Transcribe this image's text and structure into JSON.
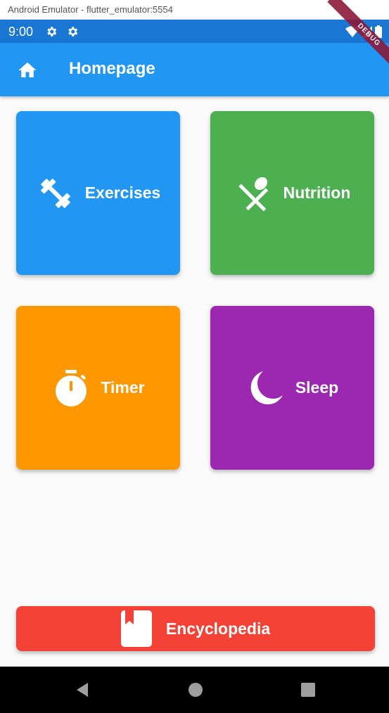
{
  "window": {
    "title": "Android Emulator - flutter_emulator:5554"
  },
  "status_bar": {
    "time": "9:00",
    "debug_label": "DEBUG"
  },
  "app_bar": {
    "title": "Homepage",
    "icon": "home-icon"
  },
  "tiles": [
    {
      "label": "Exercises",
      "icon": "dumbbell-icon",
      "color": "#2196f3"
    },
    {
      "label": "Nutrition",
      "icon": "restaurant-icon",
      "color": "#4caf50"
    },
    {
      "label": "Timer",
      "icon": "stopwatch-icon",
      "color": "#ff9800"
    },
    {
      "label": "Sleep",
      "icon": "moon-icon",
      "color": "#9c27b0"
    }
  ],
  "encyclopedia": {
    "label": "Encyclopedia",
    "icon": "book-icon",
    "color": "#f44336"
  },
  "nav": {
    "back": "back-icon",
    "home": "home-circle-icon",
    "recents": "recents-icon"
  }
}
